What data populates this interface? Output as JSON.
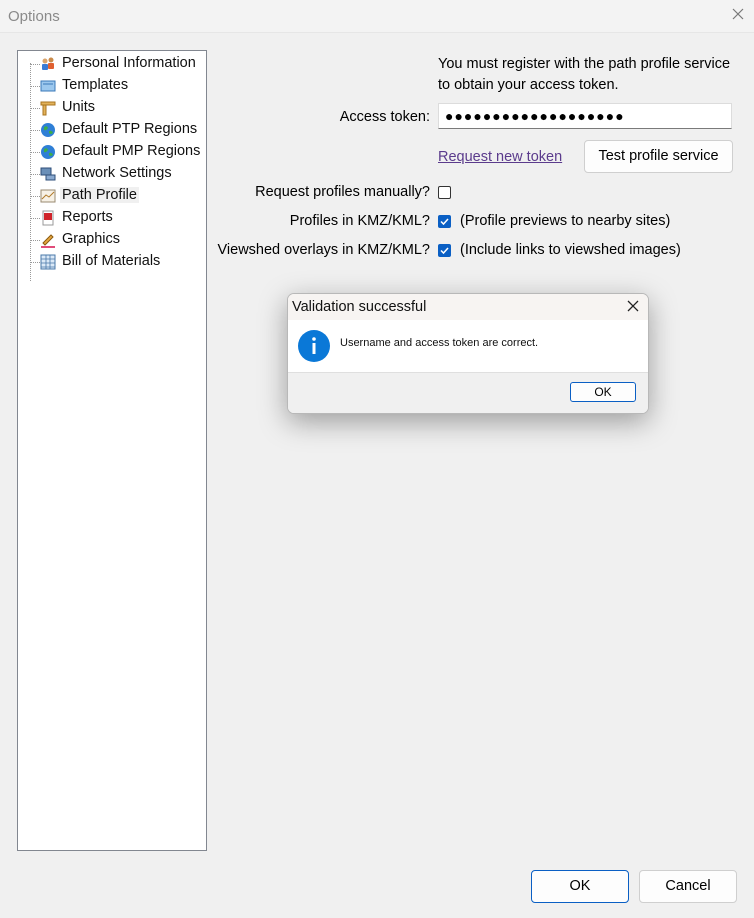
{
  "window": {
    "title": "Options",
    "close_icon": "close-icon"
  },
  "tree": {
    "items": [
      {
        "label": "Personal Information",
        "icon": "people-icon"
      },
      {
        "label": "Templates",
        "icon": "template-icon"
      },
      {
        "label": "Units",
        "icon": "ruler-icon"
      },
      {
        "label": "Default PTP Regions",
        "icon": "globe-icon"
      },
      {
        "label": "Default PMP Regions",
        "icon": "globe-icon"
      },
      {
        "label": "Network Settings",
        "icon": "network-icon"
      },
      {
        "label": "Path Profile",
        "icon": "path-profile-icon"
      },
      {
        "label": "Reports",
        "icon": "pdf-report-icon"
      },
      {
        "label": "Graphics",
        "icon": "pencil-icon"
      },
      {
        "label": "Bill of Materials",
        "icon": "table-icon"
      }
    ],
    "selected": "Path Profile"
  },
  "panel": {
    "info_line1": "You must register with the path profile service",
    "info_line2": "to obtain your access token.",
    "access_token_label": "Access token:",
    "access_token_value": "●●●●●●●●●●●●●●●●●●●",
    "request_link": "Request new token",
    "test_button": "Test profile service",
    "request_manually_label": "Request profiles manually?",
    "request_manually_checked": false,
    "kmz_label": "Profiles in KMZ/KML?",
    "kmz_checked": true,
    "kmz_note": "(Profile previews to nearby sites)",
    "viewshed_label": "Viewshed overlays in KMZ/KML?",
    "viewshed_checked": true,
    "viewshed_note": "(Include links to viewshed images)"
  },
  "dialog": {
    "title": "Validation successful",
    "message": "Username and access token are correct.",
    "ok": "OK",
    "icon": "info-icon",
    "accent": "#0a78d7"
  },
  "footer": {
    "ok": "OK",
    "cancel": "Cancel"
  },
  "colors": {
    "accent": "#0a5fc4",
    "link": "#5b3b8c"
  }
}
